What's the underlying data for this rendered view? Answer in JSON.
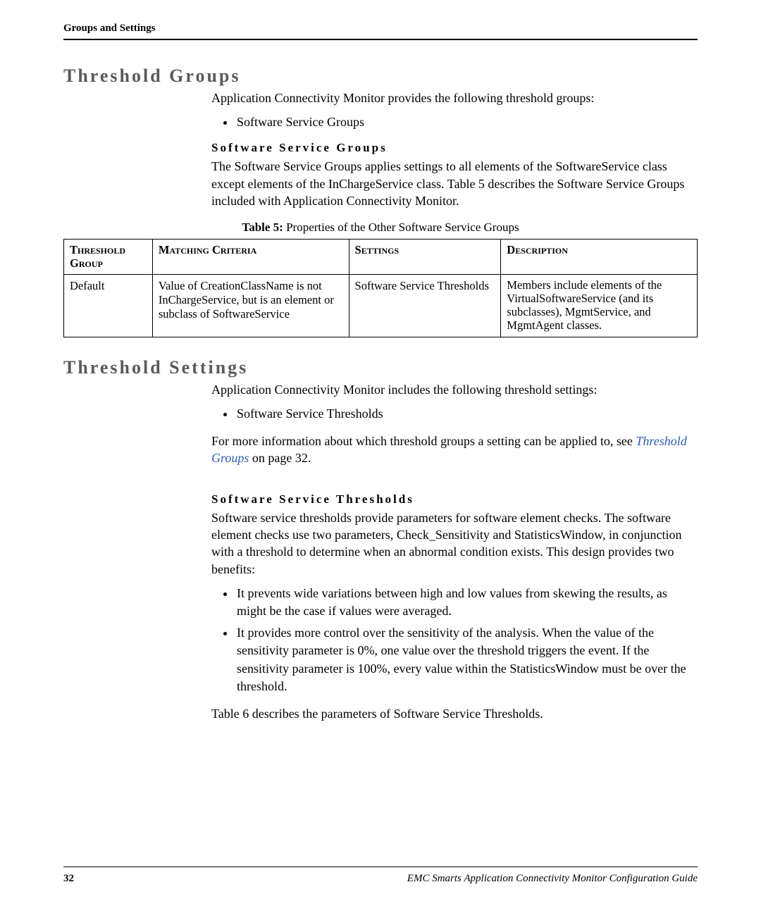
{
  "running_head": "Groups and Settings",
  "section1": {
    "title": "Threshold Groups",
    "intro": "Application Connectivity Monitor provides the following threshold groups:",
    "bullets": [
      "Software Service Groups"
    ],
    "sub": {
      "title": "Software Service Groups",
      "para": "The Software Service Groups applies settings to all elements of the SoftwareService class except elements of the InChargeService class. Table 5 describes the Software Service Groups included with Application Connectivity Monitor."
    }
  },
  "table": {
    "caption_bold": "Table 5:",
    "caption_rest": " Properties of the Other Software Service Groups",
    "headers": {
      "group": "Threshold Group",
      "criteria": "Matching Criteria",
      "settings": "Settings",
      "description": "Description"
    },
    "row": {
      "group": "Default",
      "criteria": "Value of CreationClassName is not InChargeService, but is an element or subclass of SoftwareService",
      "settings": "Software Service Thresholds",
      "description": "Members include elements of the VirtualSoftwareService (and its subclasses), MgmtService, and MgmtAgent classes."
    }
  },
  "section2": {
    "title": "Threshold Settings",
    "intro": "Application Connectivity Monitor includes the following threshold settings:",
    "bullets": [
      "Software Service Thresholds"
    ],
    "more_before": "For more information about which threshold groups a setting can be applied to, see ",
    "link_text": "Threshold Groups",
    "more_after": " on page 32.",
    "sub": {
      "title": "Software Service Thresholds",
      "para": "Software service thresholds provide parameters for software element checks. The software element checks use two parameters, Check_Sensitivity and StatisticsWindow, in conjunction with a threshold to determine when an abnormal condition exists. This design provides two benefits:",
      "bullets": [
        "It prevents wide variations between high and low values from skewing the results, as might be the case if values were averaged.",
        "It provides more control over the sensitivity of the analysis. When the value of the sensitivity parameter is 0%, one value over the threshold triggers the event. If the sensitivity parameter is 100%, every value within the StatisticsWindow must be over the threshold."
      ],
      "closing": "Table 6 describes the parameters of Software Service Thresholds."
    }
  },
  "footer": {
    "page_number": "32",
    "title": "EMC Smarts Application Connectivity Monitor Configuration Guide"
  }
}
